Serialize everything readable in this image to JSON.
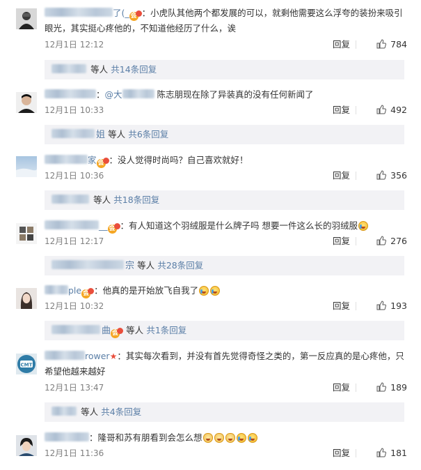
{
  "comments": [
    {
      "text": "小虎队其他两个都发展的可以，就剩他需要这么浮夸的装扮来吸引眼光，其实挺心疼他的，不知道他经历了什么，诶",
      "name_tail": "了(_",
      "time": "12月1日 12:12",
      "reply": "回复",
      "likes": "784",
      "sub_who": "等人",
      "sub_more": "共14条回复"
    },
    {
      "mention": "@大",
      "text": "陈志朋现在除了异装真的没有任何新闻了",
      "time": "12月1日 10:33",
      "reply": "回复",
      "likes": "492",
      "sub_who": "",
      "sub_more": "共6条回复",
      "sub_tail": "等人",
      "sub_tail2": "姐"
    },
    {
      "name_tail": "家",
      "text": "没人觉得时尚吗？自己喜欢就好！",
      "time": "12月1日 10:36",
      "reply": "回复",
      "likes": "356",
      "sub_who": "等人",
      "sub_more": "共18条回复"
    },
    {
      "name_tail": "__",
      "text": "有人知道这个羽绒服是什么牌子吗 想要一件这么长的羽绒服",
      "time": "12月1日 12:17",
      "reply": "回复",
      "likes": "276",
      "sub_tail2": "宗",
      "sub_who": "等人",
      "sub_more": "共28条回复"
    },
    {
      "name_tail": "ple",
      "text": "他真的是开始放飞自我了",
      "time": "12月1日 10:32",
      "reply": "回复",
      "likes": "193",
      "sub_tail2": "曲",
      "sub_who": "等人",
      "sub_more": "共1条回复"
    },
    {
      "name_tail": "rower",
      "text": "其实每次看到，并没有首先觉得奇怪之类的，第一反应真的是心疼他，只希望他越来越好",
      "time": "12月1日 13:47",
      "reply": "回复",
      "likes": "189",
      "sub_who": "等人",
      "sub_more": "共4条回复"
    },
    {
      "text": "隆哥和苏有朋看到会怎么想",
      "time": "12月1日 11:36",
      "reply": "回复",
      "likes": "181"
    }
  ],
  "icons": {
    "like": "thumbs-up-icon",
    "member_badge": "vip-badge-icon"
  },
  "colors": {
    "link": "#5a7ea6",
    "time": "#808080",
    "subbar_bg": "#f2f2f5"
  }
}
